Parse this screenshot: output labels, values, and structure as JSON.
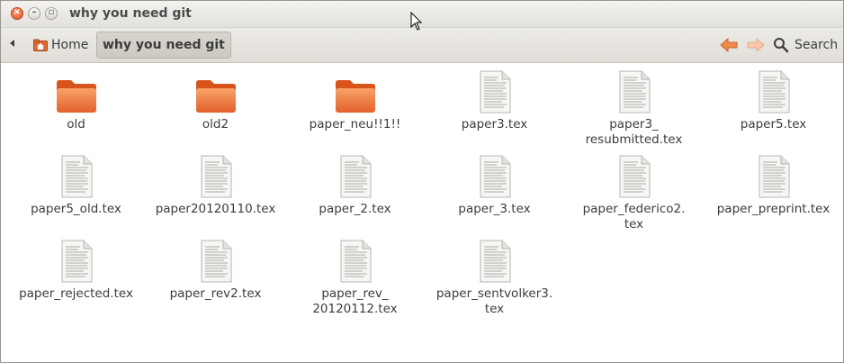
{
  "window": {
    "title": "why you need git"
  },
  "toolbar": {
    "breadcrumbs": [
      {
        "label": "Home"
      },
      {
        "label": "why you need git"
      }
    ],
    "search_label": "Search"
  },
  "items": [
    {
      "type": "folder",
      "label": "old"
    },
    {
      "type": "folder",
      "label": "old2"
    },
    {
      "type": "folder",
      "label": "paper_neu!!1!!"
    },
    {
      "type": "file",
      "label": "paper3.tex"
    },
    {
      "type": "file",
      "label_lines": [
        "paper3_",
        "resubmitted.tex"
      ]
    },
    {
      "type": "file",
      "label": "paper5.tex"
    },
    {
      "type": "file",
      "label": "paper5_old.tex"
    },
    {
      "type": "file",
      "label": "paper20120110.tex"
    },
    {
      "type": "file",
      "label": "paper_2.tex"
    },
    {
      "type": "file",
      "label": "paper_3.tex"
    },
    {
      "type": "file",
      "label_lines": [
        "paper_federico2.",
        "tex"
      ]
    },
    {
      "type": "file",
      "label": "paper_preprint.tex"
    },
    {
      "type": "file",
      "label": "paper_rejected.tex"
    },
    {
      "type": "file",
      "label": "paper_rev2.tex"
    },
    {
      "type": "file",
      "label_lines": [
        "paper_rev_",
        "20120112.tex"
      ]
    },
    {
      "type": "file",
      "label_lines": [
        "paper_sentvolker3.",
        "tex"
      ]
    }
  ],
  "colors": {
    "folder": "#e8672a",
    "folder_light": "#f59a5c",
    "accent_close": "#e0531f",
    "nav_arrow": "#f08a4b"
  }
}
